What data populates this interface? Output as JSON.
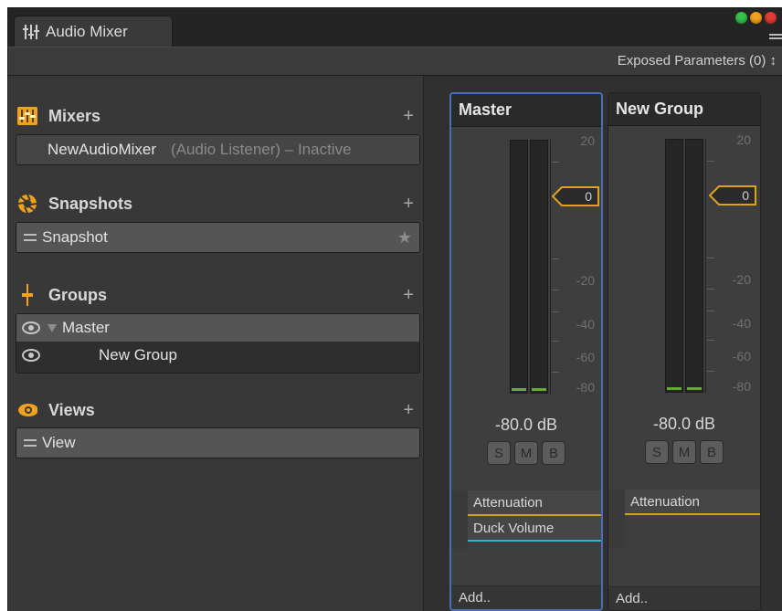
{
  "window": {
    "tab_title": "Audio Mixer",
    "traffic_colors": [
      "#33c24a",
      "#f2a31c",
      "#e23b32"
    ]
  },
  "toolbar": {
    "exposed_params": "Exposed Parameters (0) ↕"
  },
  "sections": {
    "mixers": {
      "title": "Mixers",
      "add": "+",
      "icon": "mixer-icon",
      "items": [
        {
          "name": "NewAudioMixer",
          "status": "(Audio Listener) – Inactive"
        }
      ]
    },
    "snapshots": {
      "title": "Snapshots",
      "add": "+",
      "icon": "aperture-icon",
      "items": [
        {
          "name": "Snapshot",
          "star": "★"
        }
      ]
    },
    "groups": {
      "title": "Groups",
      "add": "+",
      "icon": "fader-icon",
      "items": [
        {
          "name": "Master"
        },
        {
          "name": "New Group"
        }
      ]
    },
    "views": {
      "title": "Views",
      "add": "+",
      "icon": "eye-icon",
      "items": [
        {
          "name": "View"
        }
      ]
    }
  },
  "strips": [
    {
      "name": "Master",
      "fader": "0",
      "scale": [
        "20",
        "0",
        "-20",
        "-40",
        "-60",
        "-80"
      ],
      "db": "-80.0 dB",
      "buttons": [
        "S",
        "M",
        "B"
      ],
      "effects": [
        "Attenuation",
        "Duck Volume"
      ],
      "add": "Add.."
    },
    {
      "name": "New Group",
      "fader": "0",
      "scale": [
        "20",
        "0",
        "-20",
        "-40",
        "-60",
        "-80"
      ],
      "db": "-80.0 dB",
      "buttons": [
        "S",
        "M",
        "B"
      ],
      "effects": [
        "Attenuation"
      ],
      "add": "Add.."
    }
  ],
  "colors": {
    "accent_orange": "#f0a21c",
    "selection_blue": "#4a6fb8",
    "effect_orange": "#d3a021",
    "effect_cyan": "#2bb8d6",
    "meter_green": "#6aa83a"
  }
}
